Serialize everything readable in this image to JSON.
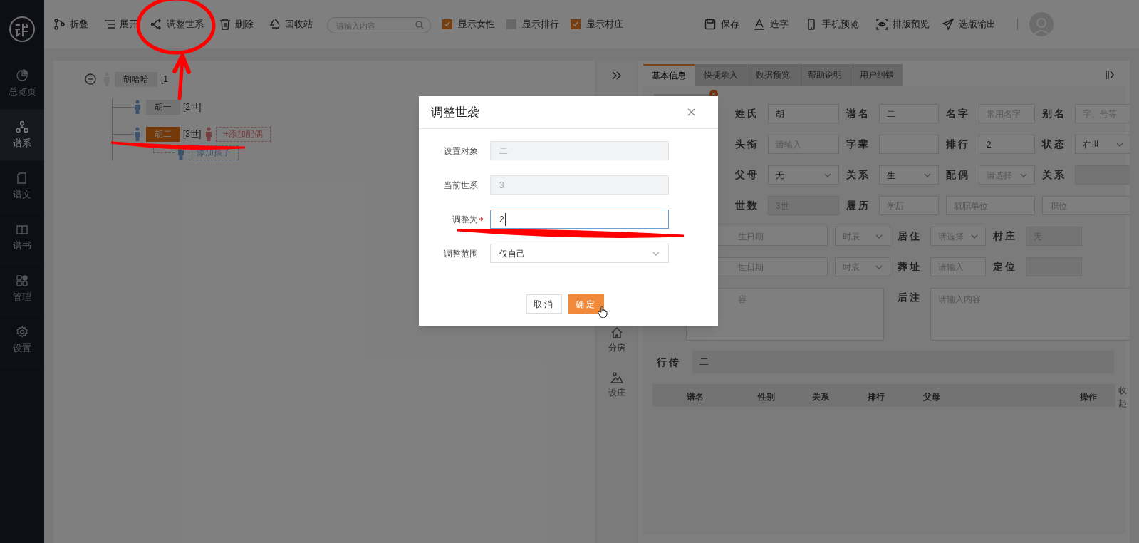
{
  "sidebar": {
    "items": [
      {
        "label": "总览页",
        "selected": false
      },
      {
        "label": "谱系",
        "selected": true
      },
      {
        "label": "谱文",
        "selected": false
      },
      {
        "label": "谱书",
        "selected": false
      },
      {
        "label": "管理",
        "selected": false
      },
      {
        "label": "设置",
        "selected": false
      }
    ]
  },
  "toolbar": {
    "actions": [
      {
        "label": "折叠"
      },
      {
        "label": "展开"
      },
      {
        "label": "调整世系"
      },
      {
        "label": "删除"
      },
      {
        "label": "回收站"
      }
    ],
    "search": {
      "placeholder": "请输入内容"
    },
    "checkboxes": [
      {
        "label": "显示女性",
        "checked": true
      },
      {
        "label": "显示排行",
        "checked": false
      },
      {
        "label": "显示村庄",
        "checked": true
      }
    ],
    "right_actions": [
      {
        "label": "保存"
      },
      {
        "label": "造字"
      },
      {
        "label": "手机预览"
      },
      {
        "label": "排版预览"
      },
      {
        "label": "选版输出"
      }
    ]
  },
  "tree": {
    "name": "胡哈哈",
    "generation": "[1",
    "expanded": true,
    "children": [
      {
        "name": "胡一",
        "generation": "[2世]",
        "selected": false
      },
      {
        "name": "胡二",
        "generation": "[3世]",
        "selected": true,
        "add_spouse": "+添加配偶",
        "add_child": "添加孩子"
      }
    ]
  },
  "side_strip": {
    "items": [
      {
        "label": "分房"
      },
      {
        "label": "设庄"
      }
    ]
  },
  "tabs": [
    {
      "label": "基本信息",
      "selected": true
    },
    {
      "label": "快捷录入",
      "selected": false
    },
    {
      "label": "数据预览",
      "selected": false
    },
    {
      "label": "帮助说明",
      "selected": false
    },
    {
      "label": "用户纠错",
      "selected": false
    }
  ],
  "form": {
    "rows": [
      [
        {
          "label": "姓氏",
          "kind": "input",
          "value": "胡"
        },
        {
          "label": "谱名",
          "kind": "input",
          "value": "二"
        },
        {
          "label": "名字",
          "kind": "input",
          "placeholder": "常用名字"
        },
        {
          "label": "别名",
          "kind": "input",
          "placeholder": "字、号等"
        }
      ],
      [
        {
          "label": "头衔",
          "kind": "input",
          "placeholder": "请输入"
        },
        {
          "label": "字辈",
          "kind": "input"
        },
        {
          "label": "排行",
          "kind": "input",
          "value": "2"
        },
        {
          "label": "状态",
          "kind": "select",
          "value": "在世"
        }
      ],
      [
        {
          "label": "父母",
          "kind": "select",
          "value": "无"
        },
        {
          "label": "关系",
          "kind": "select",
          "value": "生"
        },
        {
          "label": "配偶",
          "kind": "select",
          "placeholder": "请选择"
        },
        {
          "label": "关系",
          "kind": "disabled"
        }
      ],
      [
        {
          "label": "世数",
          "kind": "disabled",
          "value": "3世"
        },
        {
          "label": "履历",
          "kind": "input",
          "placeholder": "学历"
        },
        {
          "kind": "input",
          "placeholder": "就职单位"
        },
        {
          "kind": "input",
          "placeholder": "职位"
        }
      ],
      [
        {
          "kind": "input",
          "placeholder": "生日期"
        },
        {
          "kind": "select",
          "placeholder": "时辰"
        },
        {
          "label": "居住",
          "kind": "select",
          "placeholder": "请选择"
        },
        {
          "label": "村庄",
          "kind": "disabled",
          "value": "无"
        }
      ],
      [
        {
          "kind": "input",
          "placeholder": "世日期"
        },
        {
          "kind": "select",
          "placeholder": "时辰"
        },
        {
          "label": "葬址",
          "kind": "input",
          "placeholder": "请输入"
        },
        {
          "label": "定位",
          "kind": "disabled"
        }
      ],
      [
        {
          "kind": "textarea",
          "placeholder": "容"
        },
        {
          "label": "后注",
          "kind": "textarea",
          "placeholder": "请输入内容"
        }
      ]
    ],
    "biography": {
      "label": "行传",
      "value": "二"
    }
  },
  "table": {
    "columns": [
      "谱名",
      "性别",
      "关系",
      "排行",
      "父母",
      "操作"
    ],
    "collapse": "收起"
  },
  "modal": {
    "title": "调整世袭",
    "fields": [
      {
        "label": "设置对象",
        "kind": "disabled",
        "value": "二",
        "required": false
      },
      {
        "label": "当前世系",
        "kind": "disabled",
        "value": "3",
        "required": false
      },
      {
        "label": "调整为",
        "kind": "input",
        "value": "2",
        "required": true
      },
      {
        "label": "调整范围",
        "kind": "select",
        "value": "仅自己",
        "required": false
      }
    ],
    "buttons": [
      {
        "label": "取消",
        "primary": false
      },
      {
        "label": "确定",
        "primary": true
      }
    ]
  }
}
